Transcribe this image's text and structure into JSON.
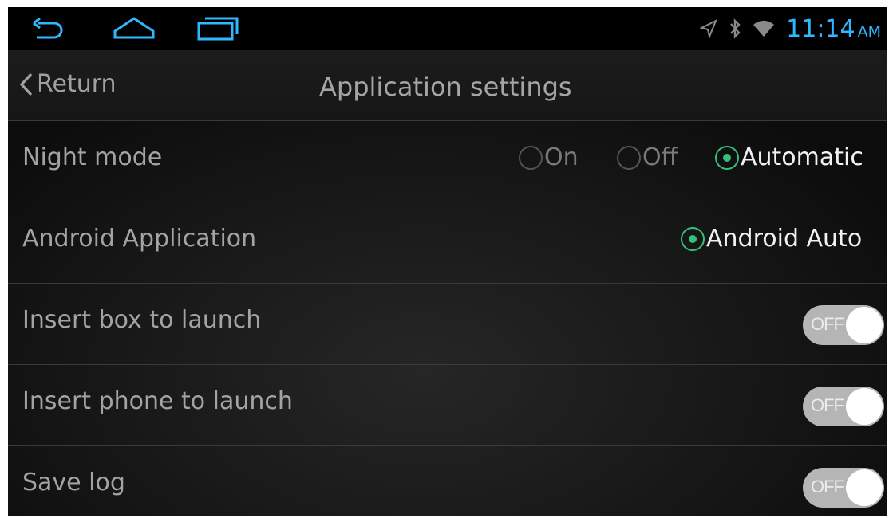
{
  "status_bar": {
    "icons": [
      "back-nav-icon",
      "home-nav-icon",
      "recents-nav-icon",
      "location-icon",
      "bluetooth-icon",
      "wifi-icon"
    ],
    "time": "11:14",
    "ampm": "AM",
    "time_color": "#2fb8ff"
  },
  "header": {
    "back_label": "Return",
    "title": "Application settings"
  },
  "settings": {
    "night_mode": {
      "label": "Night mode",
      "options": [
        "On",
        "Off",
        "Automatic"
      ],
      "selected": "Automatic"
    },
    "android_application": {
      "label": "Android Application",
      "options": [
        "Android Auto"
      ],
      "selected": "Android Auto"
    },
    "insert_box": {
      "label": "Insert box to launch",
      "state": "OFF"
    },
    "insert_phone": {
      "label": "Insert phone to launch",
      "state": "OFF"
    },
    "save_log": {
      "label": "Save log",
      "state": "OFF"
    }
  },
  "colors": {
    "accent_green": "#35c07a",
    "toggle_off_bg": "#b5b5b5"
  }
}
